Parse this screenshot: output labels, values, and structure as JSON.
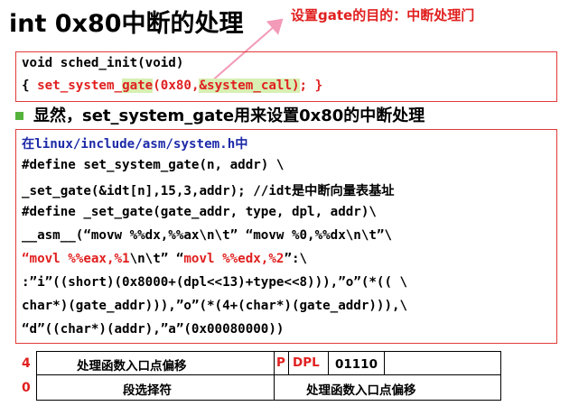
{
  "title": "int 0x80中断的处理",
  "annotation": "设置gate的目的：中断处理门",
  "box1": {
    "line1": "void sched_init(void)",
    "line2_a": "{ ",
    "line2_b": "set_system_",
    "line2_c": "gate",
    "line2_d": "(0x80,",
    "line2_e": "&system_call)",
    "line2_f": "; }"
  },
  "heading": "显然，set_system_gate用来设置0x80的中断处理",
  "code": {
    "l1": "在linux/include/asm/system.h中",
    "l2": "#define set_system_gate(n, addr) \\",
    "l3": "_set_gate(&idt[n],15,3,addr); //idt是中断向量表基址",
    "l4": "#define _set_gate(gate_addr, type, dpl, addr)\\",
    "l5": "__asm__(“movw %%dx,%%ax\\n\\t” “movw %0,%%dx\\n\\t”\\",
    "l6_a": "“",
    "l6_b": "movl %%eax,%1",
    "l6_c": "\\n\\t” “",
    "l6_d": "movl %%edx,%2",
    "l6_e": "”:\\",
    "l7": ":”i”((short)(0x8000+(dpl<<13)+type<<8))),”o”(*(( \\",
    "l8": "char*)(gate_addr))),”o”(*(4+(char*)(gate_addr))),\\",
    "l9": "“d”((char*)(addr),”a”(0x00080000))"
  },
  "table": {
    "row0_label": "4",
    "row1_label": "0",
    "r0_offset": "处理函数入口点偏移",
    "r0_p": "P",
    "r0_dpl": "DPL",
    "r0_bits": "01110",
    "r1_selector": "段选择符",
    "r1_offset": "处理函数入口点偏移"
  }
}
